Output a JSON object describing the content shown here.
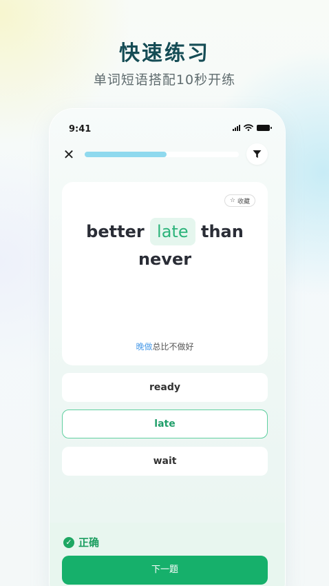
{
  "promo": {
    "headline": "快速练习",
    "subline": "单词短语搭配10秒开练"
  },
  "status_bar": {
    "time": "9:41"
  },
  "quiz": {
    "progress": 0.53,
    "favorite_label": "收藏",
    "sentence_before": "better ",
    "blank_word": "late",
    "sentence_after": " than never",
    "translation_highlight": "晚做",
    "translation_rest": "总比不做好",
    "options": [
      {
        "label": "ready",
        "state": "default"
      },
      {
        "label": "late",
        "state": "correct"
      },
      {
        "label": "wait",
        "state": "default"
      }
    ],
    "result_label": "正确",
    "next_label": "下一题"
  },
  "icons": {
    "close": "close-icon",
    "filter": "filter-icon",
    "star": "star-icon",
    "check": "check-circle-icon",
    "signal": "signal-icon",
    "wifi": "wifi-icon",
    "battery": "battery-icon"
  },
  "colors": {
    "accent_green": "#16b06b",
    "correct_text": "#2bb37a",
    "progress": "#8fd9ee",
    "headline": "#154c55",
    "translation_highlight": "#4a9be8"
  }
}
